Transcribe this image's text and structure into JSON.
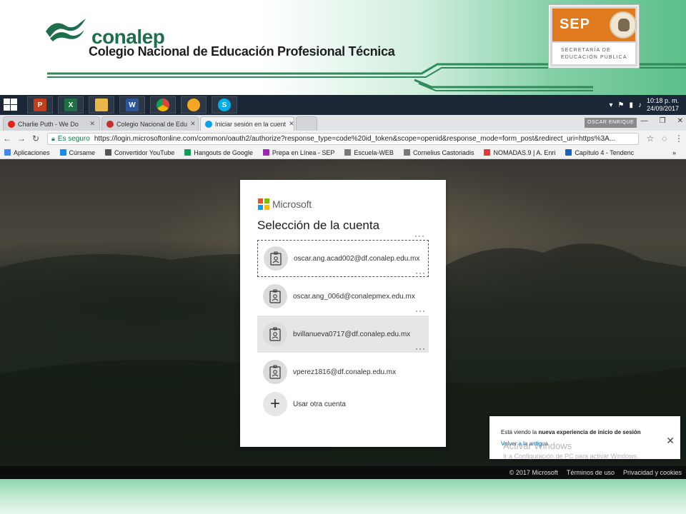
{
  "slide": {
    "brand": "conalep",
    "brand_subtitle": "Colegio Nacional de Educación Profesional Técnica",
    "sep": {
      "word": "SEP",
      "line1": "SECRETARÍA DE",
      "line2": "EDUCACIÓN PÚBLICA"
    }
  },
  "taskbar": {
    "apps": [
      {
        "icon": "powerpoint-icon",
        "glyph": "P",
        "color": "#c43e1c"
      },
      {
        "icon": "excel-icon",
        "glyph": "X",
        "color": "#1e7145"
      },
      {
        "icon": "file-explorer-icon",
        "glyph": "",
        "color": "#e8b84a"
      },
      {
        "icon": "word-icon",
        "glyph": "W",
        "color": "#2b579a"
      },
      {
        "icon": "chrome-icon",
        "glyph": "",
        "color": "#ffffff"
      },
      {
        "icon": "sun-app-icon",
        "glyph": "",
        "color": "#f5a623"
      },
      {
        "icon": "skype-icon",
        "glyph": "S",
        "color": "#00aff0"
      }
    ],
    "time": "10:18 p. m.",
    "date": "24/09/2017"
  },
  "browser": {
    "tabs": [
      {
        "label": "Charlie Puth - We Do",
        "favicon_color": "#e62117",
        "active": false
      },
      {
        "label": "Colegio Nacional de Edu",
        "favicon_color": "#c4302b",
        "active": false
      },
      {
        "label": "Iniciar sesión en la cuent",
        "favicon_color": "#00a4ef",
        "active": true
      }
    ],
    "profile": "OSCAR ENRIQUE",
    "secure_label": "Es seguro",
    "url": "https://login.microsoftonline.com/common/oauth2/authorize?response_type=code%20id_token&scope=openid&response_mode=form_post&redirect_uri=https%3A...",
    "bookmarks": [
      {
        "label": "Aplicaciones",
        "color": "#4285f4"
      },
      {
        "label": "Cúrsame",
        "color": "#1e88e5"
      },
      {
        "label": "Convertidor YouTube",
        "color": "#555555"
      },
      {
        "label": "Hangouts de Google",
        "color": "#0f9d58"
      },
      {
        "label": "Prepa en Línea - SEP",
        "color": "#9c27b0"
      },
      {
        "label": "Escuela-WEB",
        "color": "#777777"
      },
      {
        "label": "Cornelius Castoriadis",
        "color": "#777777"
      },
      {
        "label": "NOMADAS.9 | A. Enri",
        "color": "#e53935"
      },
      {
        "label": "Capítulo 4 - Tendenc",
        "color": "#1565c0"
      }
    ]
  },
  "signin": {
    "brand": "Microsoft",
    "title": "Selección de la cuenta",
    "accounts": [
      {
        "email": "oscar.ang.acad002@df.conalep.edu.mx",
        "menu": "···"
      },
      {
        "email": "oscar.ang_006d@conalepmex.edu.mx",
        "menu": "···"
      },
      {
        "email": "bvillanueva0717@df.conalep.edu.mx",
        "menu": "···"
      },
      {
        "email": "vperez1816@df.conalep.edu.mx",
        "menu": "···"
      }
    ],
    "other_account": "Usar otra cuenta"
  },
  "notice": {
    "prefix": "Está viendo la ",
    "bold": "nueva experiencia de inicio de sesión",
    "link": "Volver a la antigua",
    "activate_title": "Activar Windows",
    "activate_sub": "Ir a Configuración de PC para activar Windows."
  },
  "footer": {
    "copyright": "© 2017 Microsoft",
    "terms": "Términos de uso",
    "privacy": "Privacidad y cookies"
  }
}
